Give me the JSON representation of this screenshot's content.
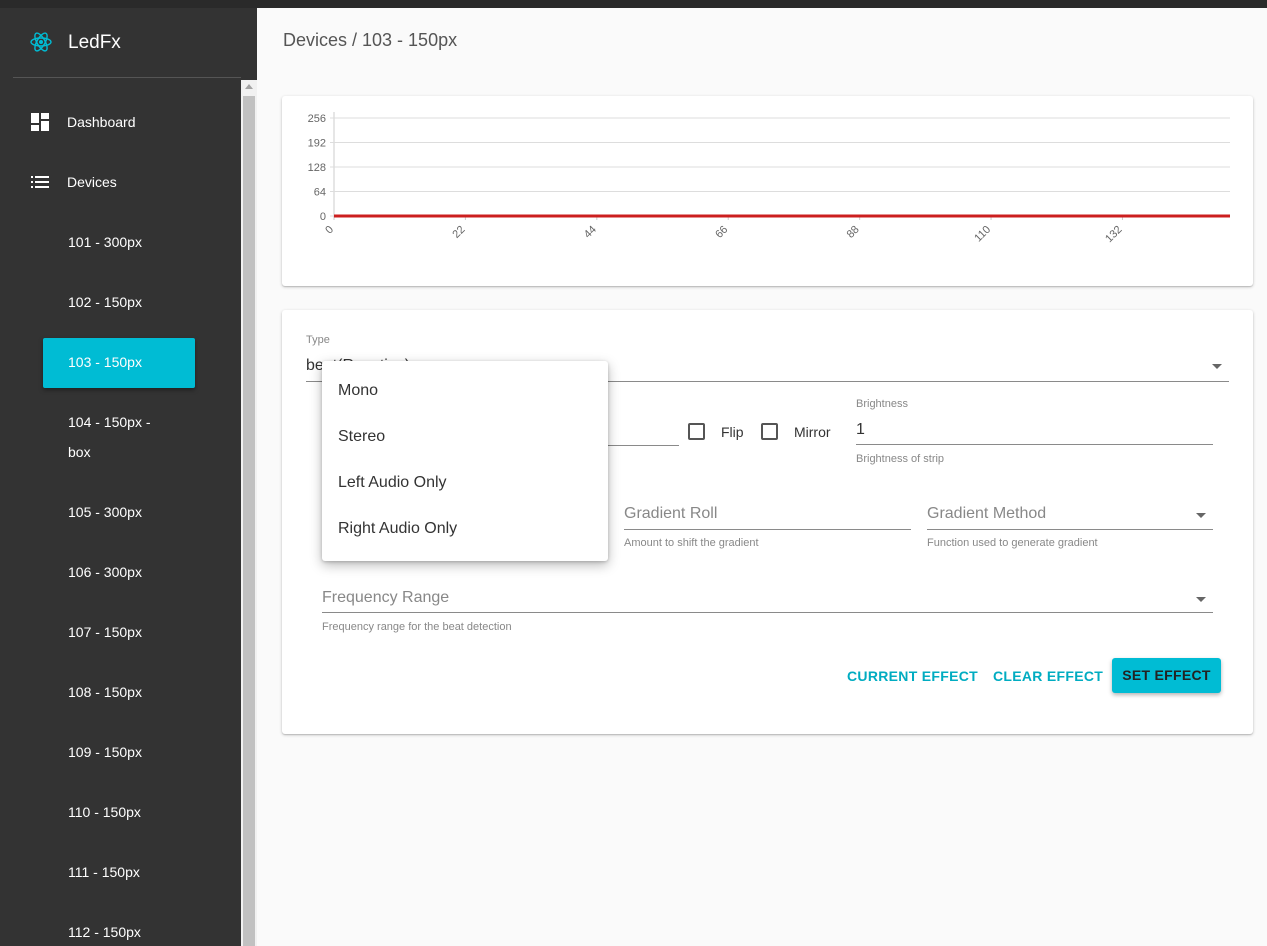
{
  "app": {
    "title": "LedFx"
  },
  "nav": [
    {
      "label": "Dashboard",
      "icon": "dashboard-icon"
    },
    {
      "label": "Devices",
      "icon": "list-icon"
    }
  ],
  "devices": [
    "101 - 300px",
    "102 - 150px",
    "103 - 150px",
    "104 - 150px -",
    "box",
    "105 - 300px",
    "106 - 300px",
    "107 - 150px",
    "108 - 150px",
    "109 - 150px",
    "110 - 150px",
    "111 - 150px",
    "112 - 150px"
  ],
  "breadcrumb": "Devices / 103 - 150px",
  "chart_data": {
    "type": "line",
    "y_ticks": [
      256,
      192,
      128,
      64,
      0
    ],
    "x_ticks": [
      0,
      22,
      44,
      66,
      88,
      110,
      132
    ],
    "ylim": [
      0,
      256
    ],
    "xlim": [
      0,
      150
    ],
    "grid": true,
    "series": [
      {
        "color": "#cc1f1f",
        "x": [
          0,
          150
        ],
        "values": [
          0,
          0
        ]
      }
    ]
  },
  "form": {
    "type_label": "Type",
    "type_value": "beat(Reactive)",
    "flip_label": "Flip",
    "mirror_label": "Mirror",
    "brightness_label": "Brightness",
    "brightness_value": "1",
    "brightness_helper": "Brightness of strip",
    "gradient_roll_placeholder": "Gradient Roll",
    "gradient_roll_helper": "Amount to shift the gradient",
    "gradient_method_placeholder": "Gradient Method",
    "gradient_method_helper": "Function used to generate gradient",
    "frequency_range_placeholder": "Frequency Range",
    "frequency_range_helper": "Frequency range for the beat detection",
    "current_effect": "CURRENT EFFECT",
    "clear_effect": "CLEAR EFFECT",
    "set_effect": "SET EFFECT"
  },
  "menu": [
    "Mono",
    "Stereo",
    "Left Audio Only",
    "Right Audio Only"
  ],
  "colors": {
    "accent": "#00bcd4",
    "sidebar": "#333333",
    "series": "#cc1f1f"
  }
}
